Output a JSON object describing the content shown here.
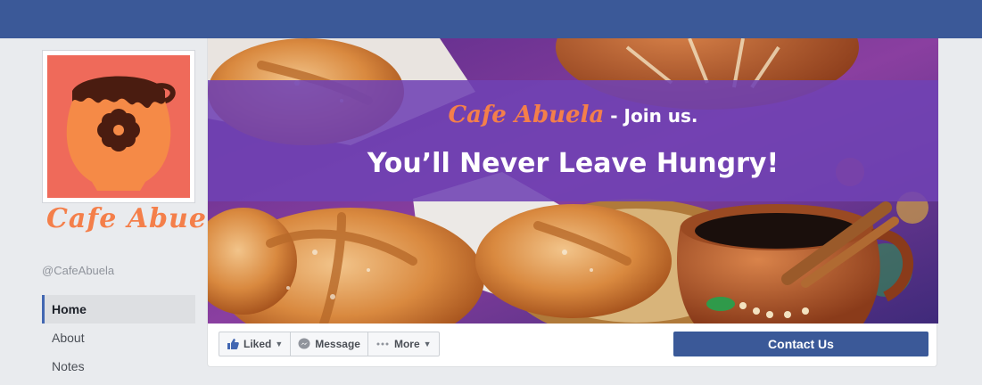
{
  "page": {
    "name": "Cafe Abuela",
    "handle": "@CafeAbuela"
  },
  "nav": {
    "items": [
      {
        "label": "Home",
        "active": true
      },
      {
        "label": "About",
        "active": false
      },
      {
        "label": "Notes",
        "active": false
      }
    ]
  },
  "cover": {
    "brand": "Cafe Abuela",
    "join": " - Join us.",
    "tagline": "You’ll Never Leave Hungry!"
  },
  "actions": {
    "liked_label": "Liked",
    "message_label": "Message",
    "more_label": "More",
    "contact_label": "Contact Us"
  },
  "icons": {
    "liked": "thumbs-up-icon",
    "message": "messenger-icon",
    "more": "more-dots-icon",
    "caret": "chevron-down-icon"
  },
  "colors": {
    "facebook_blue": "#3b5998",
    "banner_purple": "#7042b4",
    "brand_orange": "#f47f4a",
    "logo_background": "#ef6a5a"
  }
}
